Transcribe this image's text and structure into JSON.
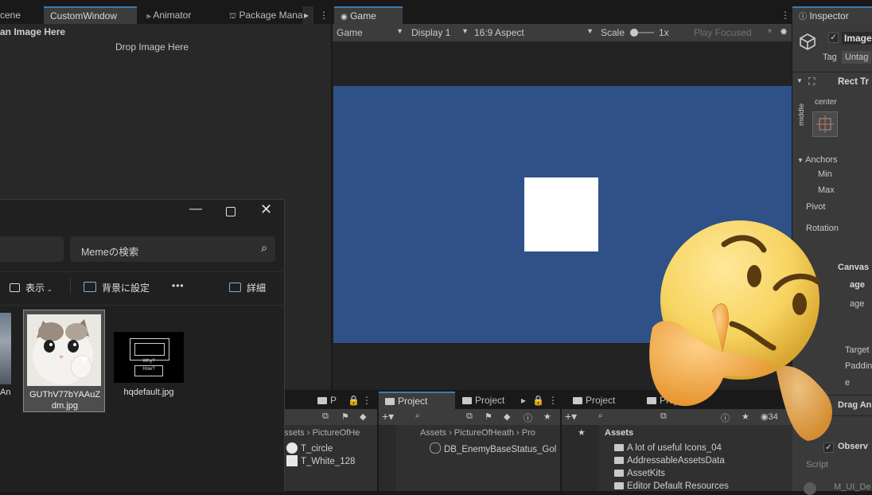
{
  "top_tabs": {
    "scene": "cene",
    "custom_window": "CustomWindow",
    "animator": "Animator",
    "package_manager": "Package Mana",
    "game": "Game",
    "inspector": "Inspector"
  },
  "custom_window": {
    "header_text": "an Image Here",
    "drop_text": "Drop Image Here"
  },
  "game_toolbar": {
    "view_mode": "Game",
    "display": "Display 1",
    "aspect": "16:9 Aspect",
    "scale_label": "Scale",
    "scale_value": "1x",
    "play_focused": "Play Focused"
  },
  "game_view": {
    "background_color": "#2f5188",
    "square_color": "#ffffff"
  },
  "inspector": {
    "component_name": "Image",
    "tag_label": "Tag",
    "tag_value": "Untag",
    "rect_transform": "Rect Tr",
    "anchor_center": "center",
    "anchor_middle": "middle",
    "anchors_label": "Anchors",
    "min_label": "Min",
    "max_label": "Max",
    "pivot_label": "Pivot",
    "rotation_label": "Rotation",
    "canvas_label": "Canvas",
    "image_label_1": "age",
    "image_label_2": "age",
    "target_label": "Target",
    "padding_label": "Paddin",
    "e_label": "e",
    "drag_label": "Drag An",
    "observer_label": "Observ",
    "script_label": "Script",
    "bottom_label": "M_UI_De"
  },
  "explorer": {
    "search_placeholder": "Memeの検索",
    "view_label": "表示",
    "background_label": "背景に設定",
    "more_label": "•••",
    "details_label": "詳細",
    "files": [
      {
        "name_line1": "An",
        "name_line2": ""
      },
      {
        "name_line1": "GUThV77bYAAuZ",
        "name_line2": "dm.jpg"
      },
      {
        "name_line1": "hqdefault.jpg",
        "name_line2": ""
      }
    ],
    "thumb_text_1": "Why?",
    "thumb_text_2": "How?"
  },
  "bottom_tabs": {
    "project_1": "Project",
    "project_2": "Project",
    "project_3": "Project",
    "project_4": "Proj",
    "small_tab": "P"
  },
  "project_panes": {
    "pane1": {
      "breadcrumb_1": "ssets",
      "breadcrumb_2": "PictureOfHe",
      "items": [
        "T_circle",
        "T_White_128"
      ]
    },
    "pane2": {
      "breadcrumb_1": "Assets",
      "breadcrumb_2": "PictureOfHeath",
      "breadcrumb_3": "Pro",
      "items": [
        "DB_EnemyBaseStatus_Gol"
      ]
    },
    "pane3": {
      "header": "Assets",
      "items": [
        "A lot of useful Icons_04",
        "AddressableAssetsData",
        "AssetKits",
        "Editor Default Resources"
      ],
      "count": "34"
    }
  }
}
